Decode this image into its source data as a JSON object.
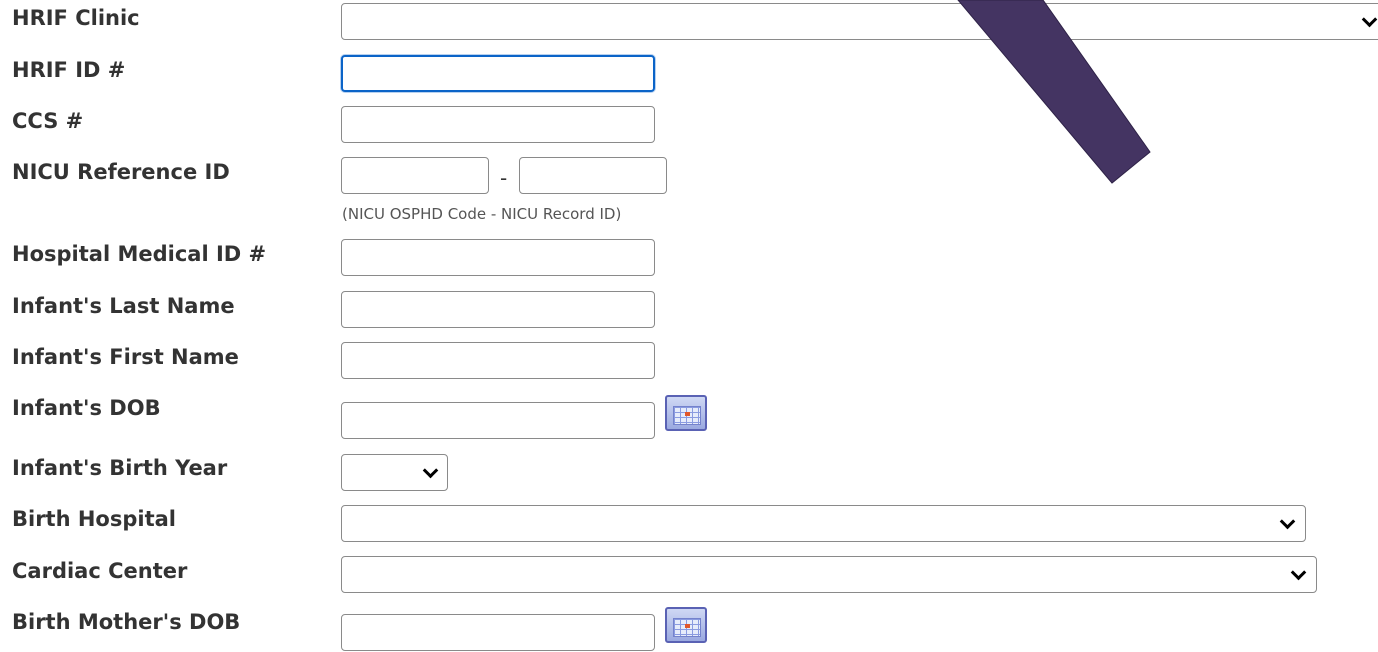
{
  "form": {
    "labels": {
      "hrif_clinic": "HRIF Clinic",
      "hrif_id": "HRIF ID #",
      "ccs": "CCS #",
      "nicu_ref": "NICU Reference ID",
      "hospital_medical_id": "Hospital Medical ID #",
      "last_name": "Infant's Last Name",
      "first_name": "Infant's First Name",
      "dob": "Infant's DOB",
      "birth_year": "Infant's Birth Year",
      "birth_hospital": "Birth Hospital",
      "cardiac_center": "Cardiac Center",
      "mother_dob": "Birth Mother's DOB"
    },
    "nicu_separator": "-",
    "nicu_hint": "(NICU OSPHD Code - NICU Record ID)",
    "values": {
      "hrif_clinic": "",
      "hrif_id": "",
      "ccs": "",
      "nicu_code": "",
      "nicu_record": "",
      "hospital_medical_id": "",
      "last_name": "",
      "first_name": "",
      "dob": "",
      "birth_year": "",
      "birth_hospital": "",
      "cardiac_center": "",
      "mother_dob": ""
    }
  },
  "icons": {
    "calendar": "calendar-icon",
    "dropdown": "chevron-down-icon"
  },
  "colors": {
    "focus_border": "#0b64c8",
    "label_text": "#333333",
    "hint_text": "#555555",
    "overlay_stroke": "#443462"
  }
}
